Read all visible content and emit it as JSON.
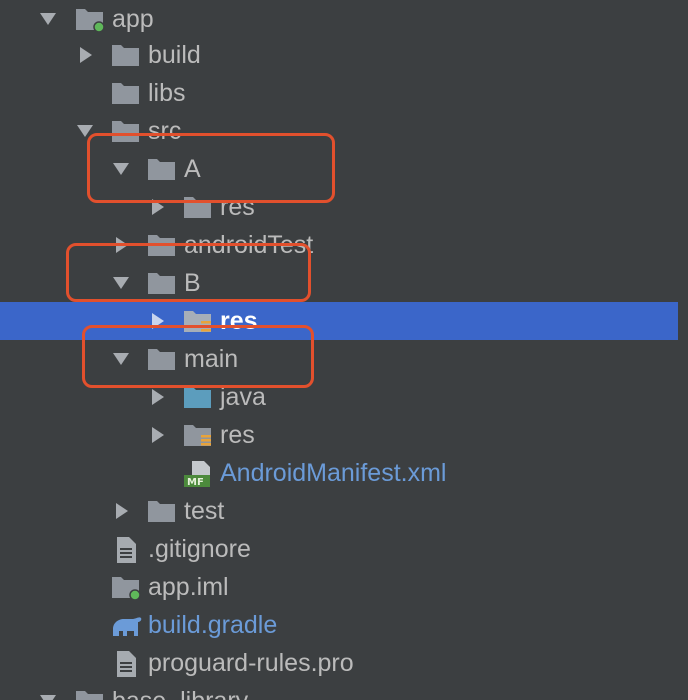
{
  "project_tree": {
    "rows": [
      {
        "label": "app",
        "expanded": true,
        "has_children": true,
        "icon": "module-folder-icon",
        "selected": false
      },
      {
        "label": "build",
        "expanded": false,
        "has_children": true,
        "icon": "folder-icon",
        "selected": false
      },
      {
        "label": "libs",
        "expanded": false,
        "has_children": false,
        "icon": "folder-icon",
        "selected": false
      },
      {
        "label": "src",
        "expanded": true,
        "has_children": true,
        "icon": "folder-icon",
        "selected": false
      },
      {
        "label": "A",
        "expanded": true,
        "has_children": true,
        "icon": "folder-icon",
        "selected": false
      },
      {
        "label": "res",
        "expanded": false,
        "has_children": true,
        "icon": "folder-icon",
        "selected": false
      },
      {
        "label": "androidTest",
        "expanded": false,
        "has_children": true,
        "icon": "folder-icon",
        "selected": false
      },
      {
        "label": "B",
        "expanded": true,
        "has_children": true,
        "icon": "folder-icon",
        "selected": false
      },
      {
        "label": "res",
        "expanded": false,
        "has_children": true,
        "icon": "resource-folder-icon",
        "selected": true
      },
      {
        "label": "main",
        "expanded": true,
        "has_children": true,
        "icon": "folder-icon",
        "selected": false
      },
      {
        "label": "java",
        "expanded": false,
        "has_children": true,
        "icon": "source-folder-icon",
        "selected": false
      },
      {
        "label": "res",
        "expanded": false,
        "has_children": true,
        "icon": "resource-folder-icon",
        "selected": false
      },
      {
        "label": "AndroidManifest.xml",
        "expanded": false,
        "has_children": false,
        "icon": "manifest-file-icon",
        "selected": false
      },
      {
        "label": "test",
        "expanded": false,
        "has_children": true,
        "icon": "folder-icon",
        "selected": false
      },
      {
        "label": ".gitignore",
        "expanded": false,
        "has_children": false,
        "icon": "text-file-icon",
        "selected": false
      },
      {
        "label": "app.iml",
        "expanded": false,
        "has_children": false,
        "icon": "module-folder-icon",
        "selected": false
      },
      {
        "label": "build.gradle",
        "expanded": false,
        "has_children": false,
        "icon": "gradle-icon",
        "selected": false
      },
      {
        "label": "proguard-rules.pro",
        "expanded": false,
        "has_children": false,
        "icon": "text-file-icon",
        "selected": false
      },
      {
        "label": "base_library",
        "expanded": true,
        "has_children": true,
        "icon": "module-folder-icon",
        "selected": false
      }
    ]
  },
  "colors": {
    "background": "#3c3f41",
    "selection": "#3b66c9",
    "text": "#bbbbbb",
    "link_text": "#6b9bd8",
    "folder": "#90969e",
    "annotation": "#e2502d"
  }
}
